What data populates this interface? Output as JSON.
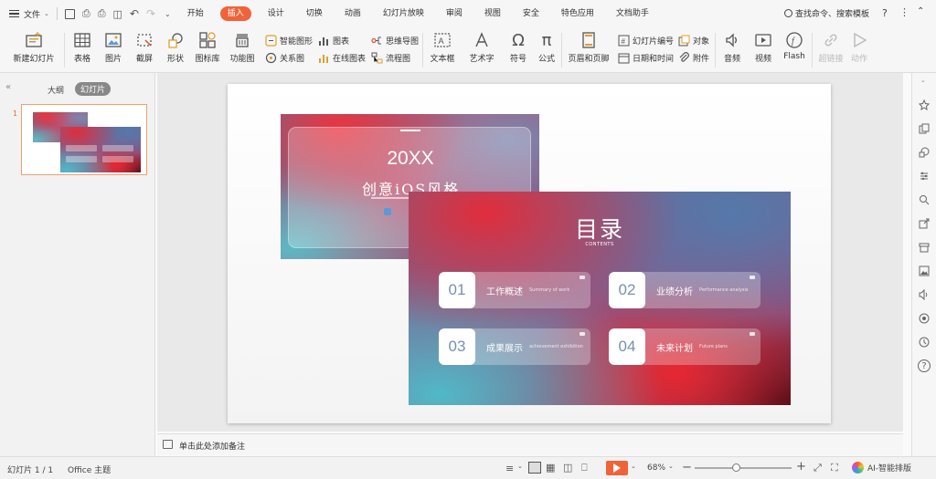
{
  "menu": {
    "file": "文件",
    "tabs": [
      "开始",
      "插入",
      "设计",
      "切换",
      "动画",
      "幻灯片放映",
      "审阅",
      "视图",
      "安全",
      "特色应用",
      "文档助手"
    ],
    "search": "查找命令、搜索模板"
  },
  "toolbar": {
    "new_slide": "新建幻灯片",
    "table": "表格",
    "picture": "图片",
    "screenshot": "截屏",
    "shape": "形状",
    "icon_lib": "图标库",
    "func_chart": "功能图",
    "smart_art": "智能图形",
    "chart": "图表",
    "mind_map": "思维导图",
    "relation": "关系图",
    "online_chart": "在线图表",
    "flowchart": "流程图",
    "textbox": "文本框",
    "wordart": "艺术字",
    "symbol": "符号",
    "formula": "公式",
    "header_footer": "页眉和页脚",
    "slide_number": "幻灯片编号",
    "object": "对象",
    "datetime": "日期和时间",
    "attachment": "附件",
    "audio": "音频",
    "video": "视频",
    "flash": "Flash",
    "hyperlink": "超链接",
    "action": "动作"
  },
  "panel": {
    "tab_outline": "大纲",
    "tab_slides": "幻灯片",
    "slide_index": "1",
    "add": "+"
  },
  "slide_back": {
    "year": "20XX",
    "subtitle": "创意iOS风格"
  },
  "slide_front": {
    "title": "目录",
    "contents": "CONTENTS",
    "items": [
      {
        "num": "01",
        "title": "工作概述",
        "sub": "Summary of work"
      },
      {
        "num": "02",
        "title": "业绩分析",
        "sub": "Performance analysis"
      },
      {
        "num": "03",
        "title": "成果展示",
        "sub": "achievement exhibition"
      },
      {
        "num": "04",
        "title": "未来计划",
        "sub": "Future plans"
      }
    ]
  },
  "notes": {
    "placeholder": "单击此处添加备注"
  },
  "status": {
    "slide_count": "幻灯片 1 / 1",
    "theme": "Office 主题",
    "zoom": "68%",
    "zoom_fraction": 0.43,
    "ai": "AI-智能排版"
  },
  "colors": {
    "accent": "#f0633a",
    "play": "#f0633a",
    "selection": "#f0a070"
  }
}
